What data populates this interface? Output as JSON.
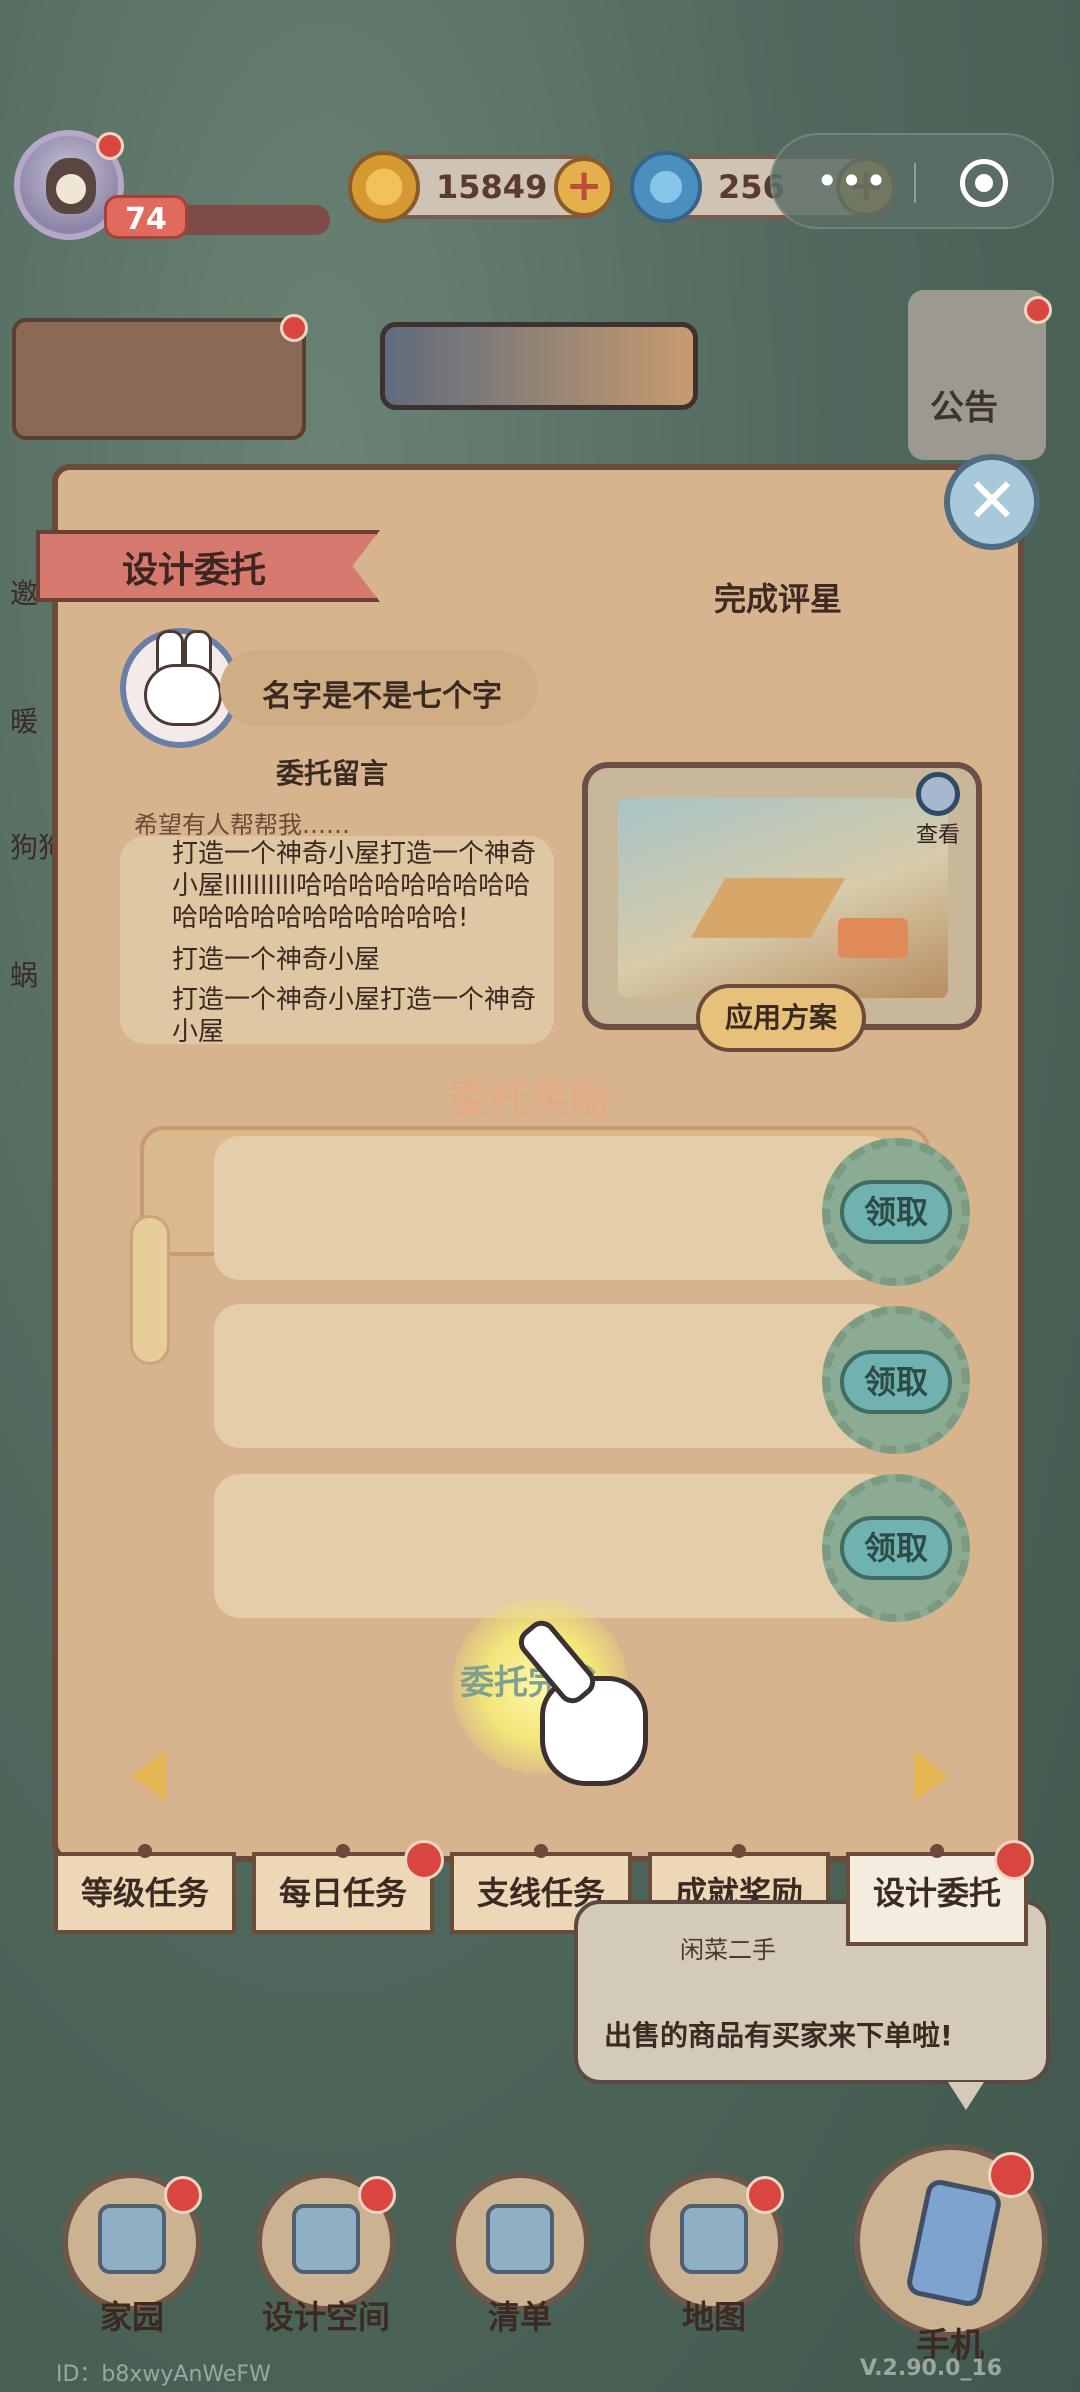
{
  "hud": {
    "level": "74",
    "coins": "15849",
    "gems": "256",
    "capsule_more": "•••"
  },
  "behind": {
    "notice": "公告",
    "side_labels": [
      "邀",
      "暖",
      "狗狗",
      "蜗"
    ]
  },
  "panel": {
    "title": "设计委托",
    "rating_title": "完成评星",
    "client_name": "名字是不是七个字",
    "message_title": "委托留言",
    "message_lead": "希望有人帮帮我……",
    "messages": [
      "打造一个神奇小屋打造一个神奇小屋llllllllll哈哈哈哈哈哈哈哈哈哈哈哈哈哈哈哈哈哈哈哈!",
      "打造一个神奇小屋",
      "打造一个神奇小屋打造一个神奇小屋"
    ],
    "preview_view": "查看",
    "apply_button": "应用方案",
    "reward_title": "委托奖励",
    "claim_label": "领取",
    "submit_label": "委托完成"
  },
  "tabs": [
    {
      "label": "等级任务",
      "active": false,
      "badge": false
    },
    {
      "label": "每日任务",
      "active": false,
      "badge": true
    },
    {
      "label": "支线任务",
      "active": false,
      "badge": false
    },
    {
      "label": "成就奖励",
      "active": false,
      "badge": false
    },
    {
      "label": "设计委托",
      "active": true,
      "badge": true
    }
  ],
  "bubble": {
    "subtitle": "闲菜二手",
    "text": "出售的商品有买家来下单啦!"
  },
  "nav": {
    "items": [
      {
        "label": "家园",
        "icon": "house-icon"
      },
      {
        "label": "设计空间",
        "icon": "ruler-icon"
      },
      {
        "label": "清单",
        "icon": "list-icon"
      },
      {
        "label": "地图",
        "icon": "map-pin-icon"
      }
    ],
    "phone": {
      "label": "手机",
      "icon": "phone-icon"
    }
  },
  "footer": {
    "id_text": "ID：b8xwyAnWeFW",
    "version": "V.2.90.0_16"
  },
  "colors": {
    "panel_bg": "#d7b48d",
    "ribbon": "#d67a70",
    "badge_red": "#d8463f",
    "claim_button": "#6fb2b0"
  }
}
